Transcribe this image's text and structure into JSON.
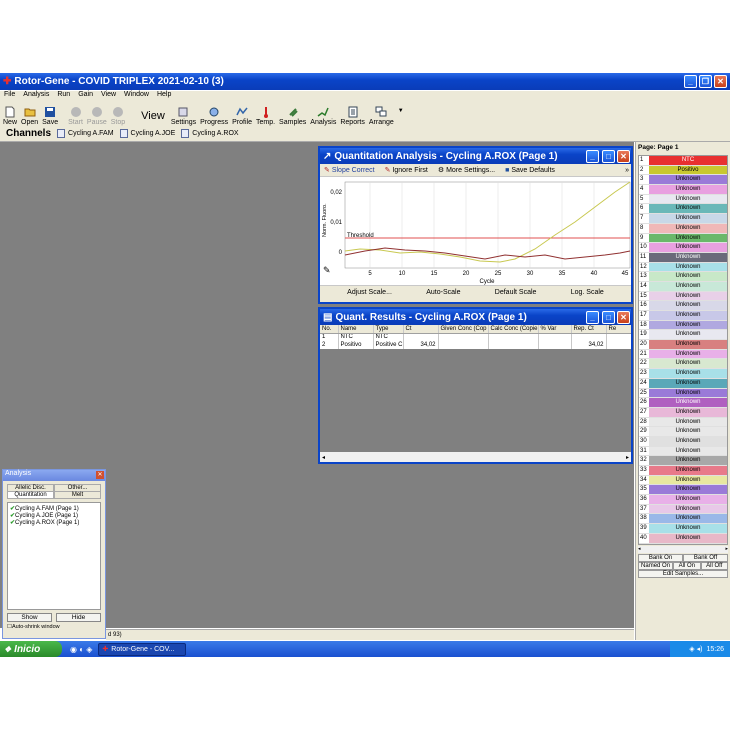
{
  "window": {
    "title": "Rotor-Gene - COVID TRIPLEX 2021-02-10 (3)"
  },
  "menu": [
    "File",
    "Analysis",
    "Run",
    "Gain",
    "View",
    "Window",
    "Help"
  ],
  "toolbar": {
    "new": "New",
    "open": "Open",
    "save": "Save",
    "start": "Start",
    "pause": "Pause",
    "stop": "Stop",
    "view": "View",
    "settings": "Settings",
    "progress": "Progress",
    "profile": "Profile",
    "temp": "Temp.",
    "samples": "Samples",
    "analysis": "Analysis",
    "reports": "Reports",
    "arrange": "Arrange"
  },
  "channels": {
    "label": "Channels",
    "tabs": [
      "Cycling A.FAM",
      "Cycling A.JOE",
      "Cycling A.ROX"
    ]
  },
  "quant": {
    "title": "Quantitation Analysis - Cycling A.ROX (Page 1)",
    "slope": "Slope Correct",
    "ignore": "Ignore First",
    "more": "More Settings...",
    "save": "Save Defaults",
    "adjust": "Adjust Scale...",
    "auto": "Auto-Scale",
    "default": "Default Scale",
    "log": "Log. Scale",
    "ylabel": "Norm. Fluoro.",
    "xlabel": "Cycle",
    "threshold": "Threshold",
    "yticks": [
      "0,02",
      "0,01",
      "0"
    ],
    "xticks": [
      "5",
      "10",
      "15",
      "20",
      "25",
      "30",
      "35",
      "40",
      "45"
    ]
  },
  "results": {
    "title": "Quant. Results - Cycling A.ROX (Page 1)",
    "cols": [
      "No.",
      "Name",
      "Type",
      "Ct",
      "Given Conc (Cop",
      "Calc Conc (Copie",
      "% Var",
      "Rep. Ct",
      "Re"
    ],
    "rows": [
      [
        "1",
        "NTC",
        "NTC",
        "",
        "",
        "",
        "",
        "",
        ""
      ],
      [
        "2",
        "Positivo",
        "Positive C",
        "34,02",
        "",
        "",
        "",
        "34,02",
        ""
      ]
    ]
  },
  "analysis_panel": {
    "title": "Analysis",
    "tabs": [
      "Allelic Disc.",
      "Other...",
      "Quantitation",
      "Melt"
    ],
    "items": [
      "Cycling A.FAM (Page 1)",
      "Cycling A.JOE (Page 1)",
      "Cycling A.ROX (Page 1)"
    ],
    "show": "Show",
    "hide": "Hide",
    "autoshrink": "Auto-shrink window"
  },
  "status": {
    "text": "d 93)"
  },
  "samples": {
    "page": "Page: Page 1",
    "rows": [
      {
        "n": "1",
        "name": "NTC",
        "color": "#e83030"
      },
      {
        "n": "2",
        "name": "Positivo",
        "color": "#c8c830"
      },
      {
        "n": "3",
        "name": "Unknown",
        "color": "#9a7ad8"
      },
      {
        "n": "4",
        "name": "Unknown",
        "color": "#e8a0e0"
      },
      {
        "n": "5",
        "name": "Unknown",
        "color": "#e8e8f0"
      },
      {
        "n": "6",
        "name": "Unknown",
        "color": "#6ab8b8"
      },
      {
        "n": "7",
        "name": "Unknown",
        "color": "#c8d8e8"
      },
      {
        "n": "8",
        "name": "Unknown",
        "color": "#f0b8b8"
      },
      {
        "n": "9",
        "name": "Unknown",
        "color": "#6ab86a"
      },
      {
        "n": "10",
        "name": "Unknown",
        "color": "#e8a0e0"
      },
      {
        "n": "11",
        "name": "Unknown",
        "color": "#6a6a7a"
      },
      {
        "n": "12",
        "name": "Unknown",
        "color": "#a8e0e8"
      },
      {
        "n": "13",
        "name": "Unknown",
        "color": "#c8e8c8"
      },
      {
        "n": "14",
        "name": "Unknown",
        "color": "#c8e8d8"
      },
      {
        "n": "15",
        "name": "Unknown",
        "color": "#e8d0e8"
      },
      {
        "n": "16",
        "name": "Unknown",
        "color": "#d8d8e8"
      },
      {
        "n": "17",
        "name": "Unknown",
        "color": "#c8c8e8"
      },
      {
        "n": "18",
        "name": "Unknown",
        "color": "#b0a8e0"
      },
      {
        "n": "19",
        "name": "Unknown",
        "color": "#e8e8f0"
      },
      {
        "n": "20",
        "name": "Unknown",
        "color": "#d88080"
      },
      {
        "n": "21",
        "name": "Unknown",
        "color": "#e8b0e8"
      },
      {
        "n": "22",
        "name": "Unknown",
        "color": "#d8e8d0"
      },
      {
        "n": "23",
        "name": "Unknown",
        "color": "#a8e0e8"
      },
      {
        "n": "24",
        "name": "Unknown",
        "color": "#5aa8b8"
      },
      {
        "n": "25",
        "name": "Unknown",
        "color": "#9a7ad8"
      },
      {
        "n": "26",
        "name": "Unknown",
        "color": "#b060c0"
      },
      {
        "n": "27",
        "name": "Unknown",
        "color": "#e8b8d8"
      },
      {
        "n": "28",
        "name": "Unknown",
        "color": "#e8e8e8"
      },
      {
        "n": "29",
        "name": "Unknown",
        "color": "#e8e8e8"
      },
      {
        "n": "30",
        "name": "Unknown",
        "color": "#e0e0e0"
      },
      {
        "n": "31",
        "name": "Unknown",
        "color": "#e8e8e8"
      },
      {
        "n": "32",
        "name": "Unknown",
        "color": "#a8a8a8"
      },
      {
        "n": "33",
        "name": "Unknown",
        "color": "#e87a8a"
      },
      {
        "n": "34",
        "name": "Unknown",
        "color": "#e8e8a0"
      },
      {
        "n": "35",
        "name": "Unknown",
        "color": "#9a7ad8"
      },
      {
        "n": "36",
        "name": "Unknown",
        "color": "#e8b0e8"
      },
      {
        "n": "37",
        "name": "Unknown",
        "color": "#e8c8e8"
      },
      {
        "n": "38",
        "name": "Unknown",
        "color": "#9ab8e8"
      },
      {
        "n": "39",
        "name": "Unknown",
        "color": "#a8e0e8"
      },
      {
        "n": "40",
        "name": "Unknown",
        "color": "#e8b8c8"
      }
    ],
    "bank_on": "Bank On",
    "bank_off": "Bank Off",
    "named_on": "Named On",
    "all_on": "All On",
    "all_off": "All Off",
    "edit": "Edit Samples..."
  },
  "taskbar": {
    "start": "Inicio",
    "task": "Rotor-Gene - COV...",
    "time": "15:26"
  }
}
